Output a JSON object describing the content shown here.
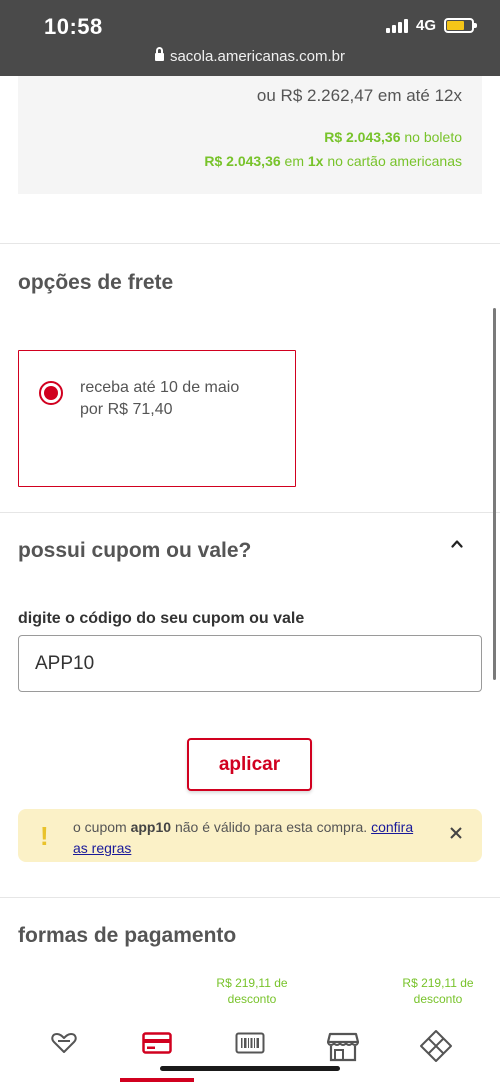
{
  "status_bar": {
    "time": "10:58",
    "network": "4G",
    "url": "sacola.americanas.com.br"
  },
  "prices": {
    "installments": "ou R$ 2.262,47 em até 12x",
    "boleto_value": "R$ 2.043,36",
    "boleto_suffix": " no boleto",
    "card_value": "R$ 2.043,36",
    "card_mid": " em ",
    "card_times": "1x",
    "card_suffix": " no cartão americanas"
  },
  "shipping": {
    "title": "opções de frete",
    "option_line1": "receba até 10 de maio",
    "option_line2": "por R$ 71,40",
    "selected": true
  },
  "coupon": {
    "title": "possui cupom ou vale?",
    "field_label": "digite o código do seu cupom ou vale",
    "value": "APP10",
    "apply_label": "aplicar",
    "alert_prefix": "o cupom ",
    "alert_code": "app10",
    "alert_middle": " não é válido para esta compra. ",
    "alert_link": "confira as regras"
  },
  "payment": {
    "title": "formas de pagamento",
    "discounts": [
      {
        "line1": "R$ 219,11 de",
        "line2": "desconto"
      },
      {
        "line1": "R$ 219,11 de",
        "line2": "desconto"
      }
    ]
  },
  "bottom_nav": {
    "items": [
      "favorites-icon",
      "credit-card-icon",
      "barcode-icon",
      "store-icon",
      "pix-icon"
    ],
    "active_index": 1
  },
  "colors": {
    "brand_red": "#d1001f",
    "discount_green": "#78c32b",
    "alert_bg": "#fbf1c7",
    "status_bar": "#4a4a4a"
  }
}
